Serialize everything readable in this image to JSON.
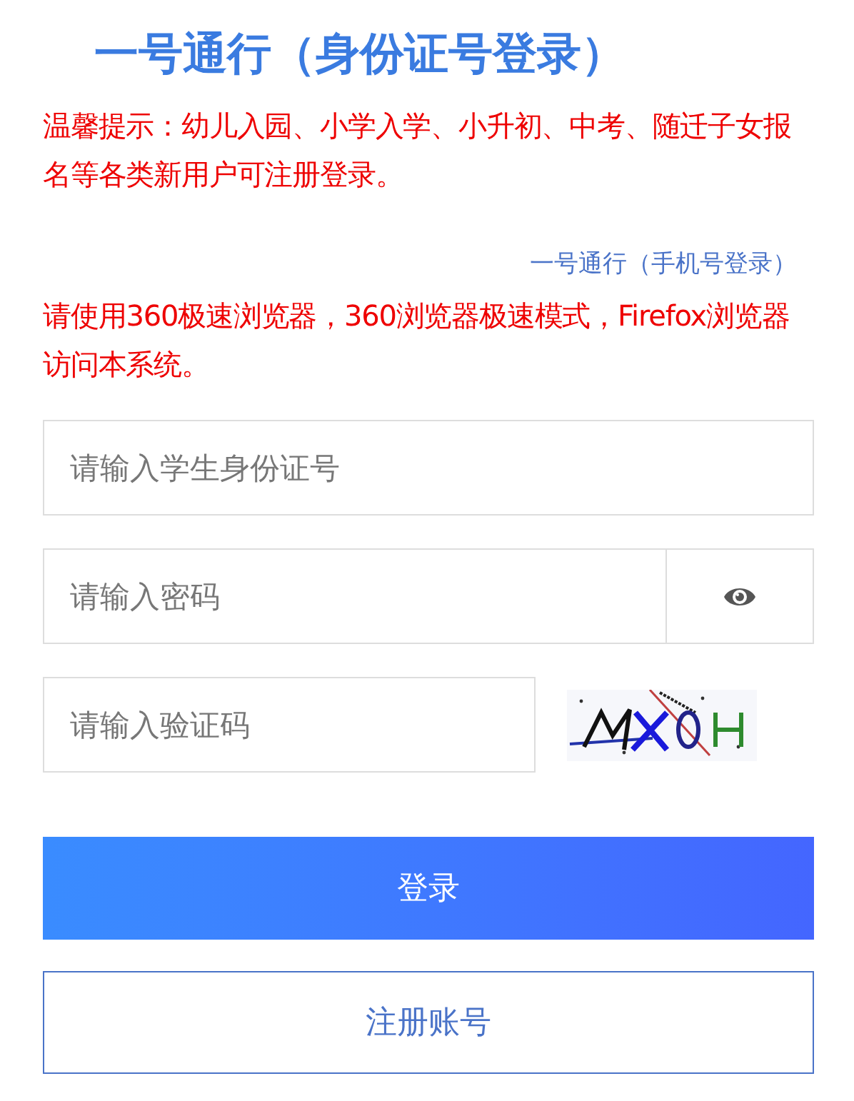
{
  "title": "一号通行（身份证号登录）",
  "notice": "温馨提示：幼儿入园、小学入学、小升初、中考、随迁子女报名等各类新用户可注册登录。",
  "alt_login_link": "一号通行（手机号登录）",
  "browser_note": "请使用360极速浏览器，360浏览器极速模式，Firefox浏览器访问本系统。",
  "fields": [
    {
      "kind": "text",
      "placeholder": "请输入学生身份证号"
    },
    {
      "kind": "password",
      "placeholder": "请输入密码"
    },
    {
      "kind": "captcha",
      "placeholder": "请输入验证码"
    }
  ],
  "buttons": [
    {
      "kind": "primary",
      "label": "登录"
    },
    {
      "kind": "outline",
      "label": "注册账号"
    }
  ]
}
